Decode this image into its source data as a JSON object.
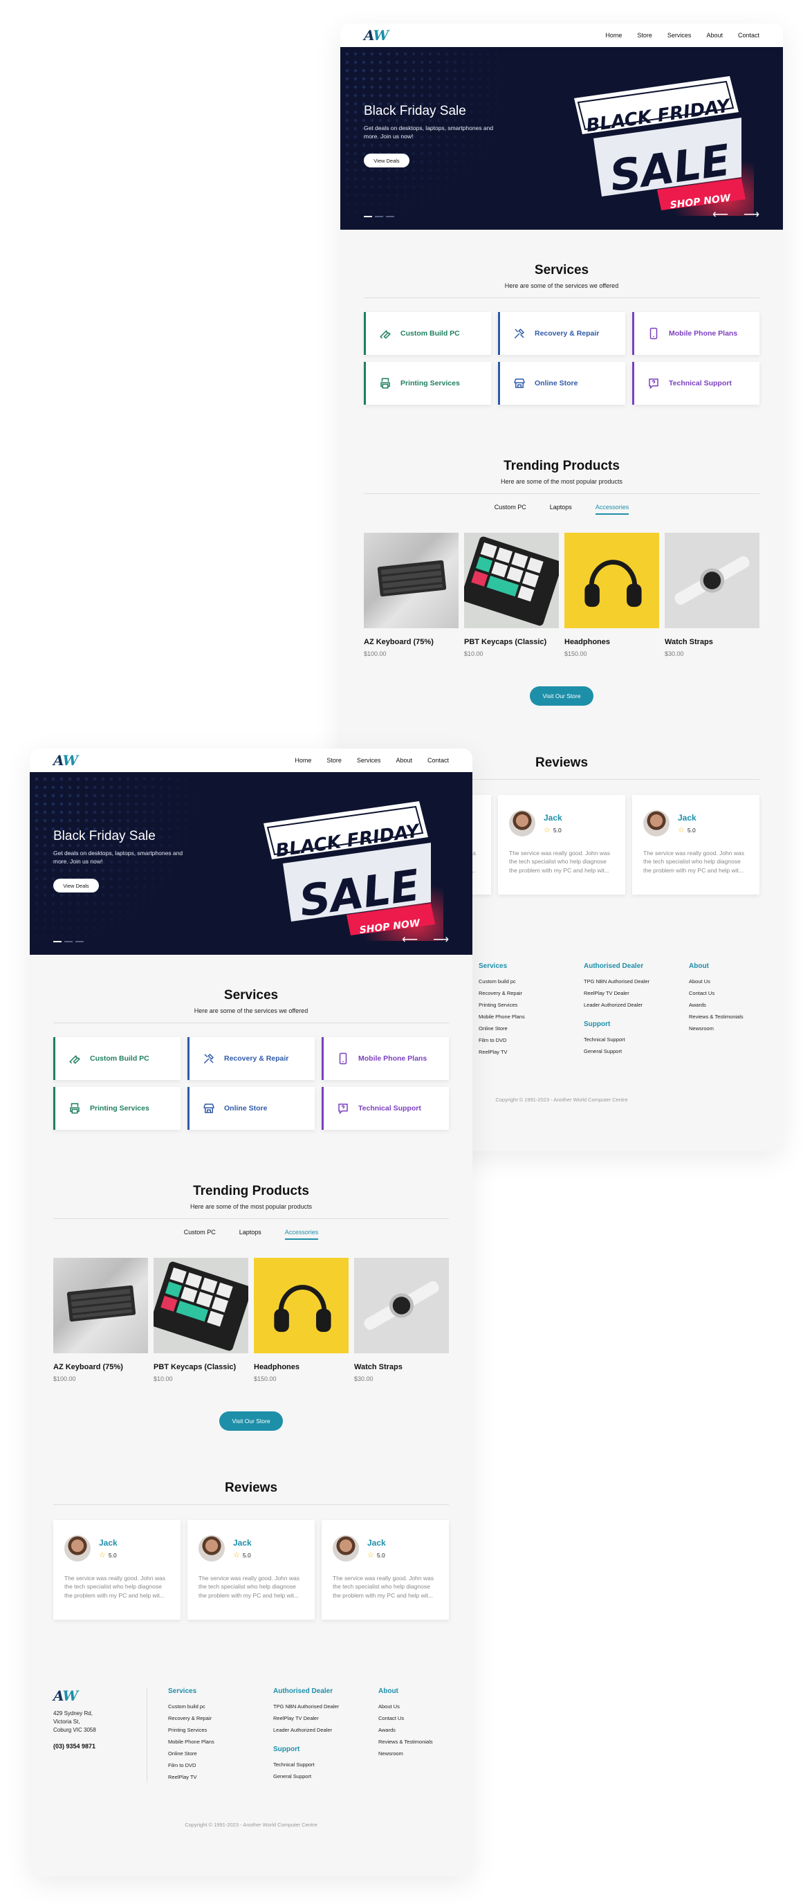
{
  "brand": {
    "logo_a": "A",
    "logo_w": "W"
  },
  "nav": {
    "home": "Home",
    "store": "Store",
    "services": "Services",
    "about": "About",
    "contact": "Contact"
  },
  "hero": {
    "title": "Black Friday Sale",
    "desc": "Get deals on desktops, laptops, smartphones and more. Join us now!",
    "cta": "View Deals",
    "banner": {
      "line1": "BLACK FRIDAY",
      "line2": "SALE",
      "button": "SHOP NOW"
    },
    "prev_icon": "arrow-left",
    "next_icon": "arrow-right"
  },
  "services": {
    "title": "Services",
    "subtitle": "Here are some of the services we offered",
    "items": [
      {
        "label": "Custom Build PC",
        "icon": "wrench-icon",
        "color": "#1f7f5c"
      },
      {
        "label": "Recovery & Repair",
        "icon": "tools-icon",
        "color": "#2f5aa8"
      },
      {
        "label": "Mobile Phone Plans",
        "icon": "phone-icon",
        "color": "#7b3fbf"
      },
      {
        "label": "Printing Services",
        "icon": "printer-icon",
        "color": "#1f7f5c"
      },
      {
        "label": "Online Store",
        "icon": "store-icon",
        "color": "#2f5aa8"
      },
      {
        "label": "Technical Support",
        "icon": "help-icon",
        "color": "#7b3fbf"
      }
    ]
  },
  "trending": {
    "title": "Trending Products",
    "subtitle": "Here are some of the most popular products",
    "tabs": [
      "Custom PC",
      "Laptops",
      "Accessories"
    ],
    "active_tab": "Accessories",
    "products": [
      {
        "name": "AZ Keyboard (75%)",
        "price": "$100.00"
      },
      {
        "name": "PBT Keycaps (Classic)",
        "price": "$10.00"
      },
      {
        "name": "Headphones",
        "price": "$150.00"
      },
      {
        "name": "Watch Straps",
        "price": "$30.00"
      }
    ],
    "cta": "Visit Our Store"
  },
  "reviews": {
    "title": "Reviews",
    "items": [
      {
        "name": "Jack",
        "rating": "5.0",
        "text": "The service was really good. John was the tech specialist who help diagnose the problem with my PC and help wit..."
      },
      {
        "name": "Jack",
        "rating": "5.0",
        "text": "The service was really good. John was the tech specialist who help diagnose the problem with my PC and help wit..."
      },
      {
        "name": "Jack",
        "rating": "5.0",
        "text": "The service was really good. John was the tech specialist who help diagnose the problem with my PC and help wit..."
      }
    ]
  },
  "footer": {
    "address": [
      "429 Sydney Rd,",
      "Victoria St,",
      "Coburg VIC 3058"
    ],
    "phone": "(03) 9354 9871",
    "services_title": "Services",
    "services": [
      "Custom build pc",
      "Recovery & Repair",
      "Printing Services",
      "Mobile Phone Plans",
      "Online Store",
      "Film to DVD",
      "ReelPlay TV"
    ],
    "dealer_title": "Authorised Dealer",
    "dealer": [
      "TPG NBN Authorised Dealer",
      "ReelPlay TV Dealer",
      "Leader Authorized Dealer"
    ],
    "support_title": "Support",
    "support": [
      "Technical Support",
      "General Support"
    ],
    "about_title": "About",
    "about": [
      "About Us",
      "Contact Us",
      "Awards",
      "Reviews & Testimonials",
      "Newsroom"
    ],
    "copyright": "Copyright © 1991-2023 - Another World Computer Centre"
  },
  "colors": {
    "accent": "#1e8faa",
    "hero_bg": "#0e1430",
    "green": "#1f7f5c",
    "blue": "#2f5aa8",
    "purple": "#7b3fbf"
  }
}
